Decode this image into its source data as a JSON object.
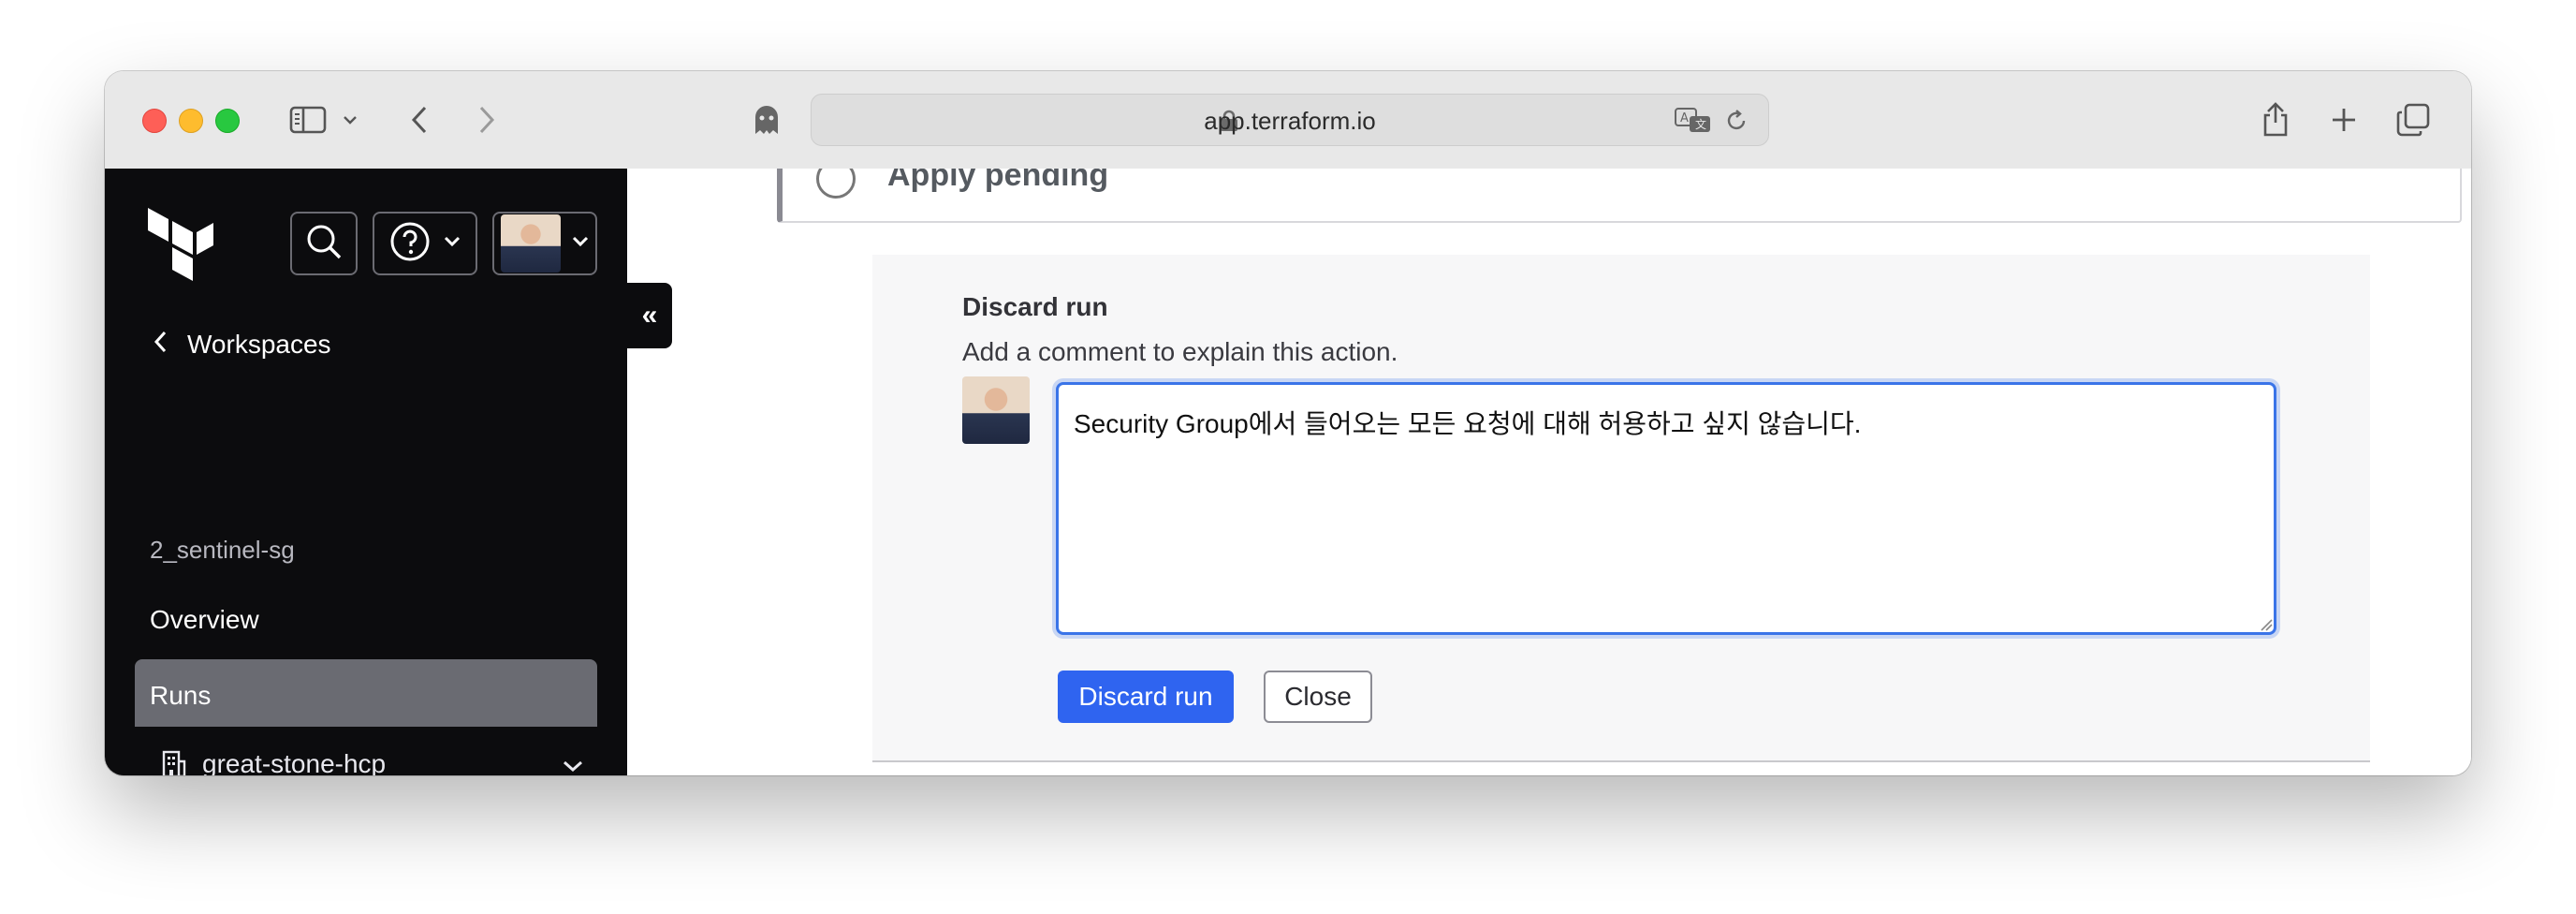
{
  "browser": {
    "url": "app.terraform.io"
  },
  "sidebar": {
    "back_label": "Workspaces",
    "workspace_name": "2_sentinel-sg",
    "nav": {
      "overview": "Overview",
      "runs": "Runs"
    },
    "organization": "great-stone-hcp",
    "collapse_glyph": "«"
  },
  "main": {
    "status_card": {
      "status": "Apply pending"
    },
    "discard_panel": {
      "title": "Discard run",
      "subtitle": "Add a comment to explain this action.",
      "comment_value": "Security Group에서 들어오는 모든 요청에 대해 허용하고 싶지 않습니다.",
      "primary_button": "Discard run",
      "secondary_button": "Close"
    }
  },
  "colors": {
    "sidebar_bg": "#0c0c0e",
    "accent_blue": "#2f64f0",
    "focus_ring": "#3a74e8",
    "active_nav": "#6a6b72"
  },
  "icons": [
    "sidebar-toggle-icon",
    "chevron-down-icon",
    "back-icon",
    "forward-icon",
    "privacy-ghost-icon",
    "lock-icon",
    "translate-icon",
    "reload-icon",
    "share-icon",
    "new-tab-icon",
    "tab-overview-icon",
    "terraform-logo",
    "search-icon",
    "help-icon",
    "chevron-left-icon",
    "building-icon"
  ]
}
